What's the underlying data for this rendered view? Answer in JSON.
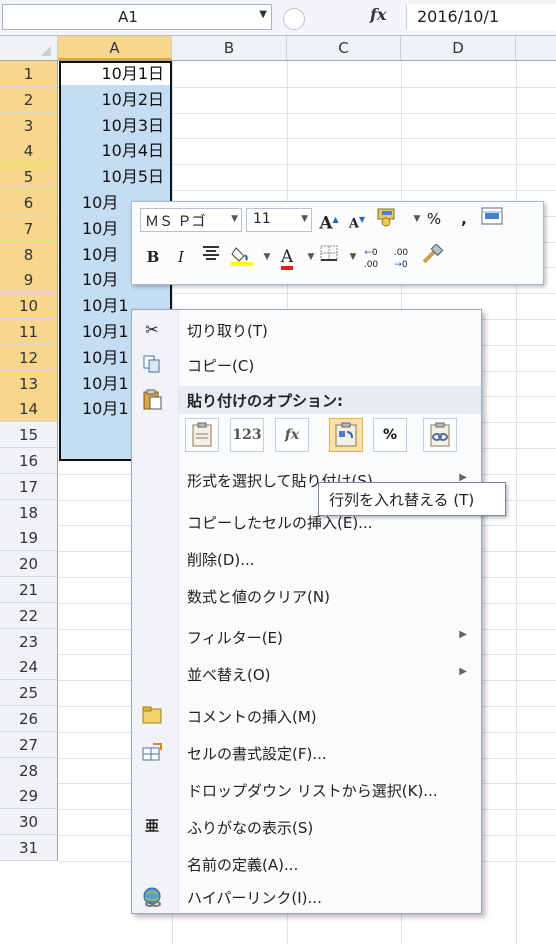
{
  "formula_bar": {
    "name_box": "A1",
    "fx_label": "fx",
    "value": "2016/10/1"
  },
  "columns": [
    "A",
    "B",
    "C",
    "D"
  ],
  "rows": [
    "1",
    "2",
    "3",
    "4",
    "5",
    "6",
    "7",
    "8",
    "9",
    "10",
    "11",
    "12",
    "13",
    "14",
    "15",
    "16",
    "17",
    "18",
    "19",
    "20",
    "21",
    "22",
    "23",
    "24",
    "25",
    "26",
    "27",
    "28",
    "29",
    "30",
    "31"
  ],
  "cells_a": [
    "10月1日",
    "10月2日",
    "10月3日",
    "10月4日",
    "10月5日",
    "10月",
    "10月",
    "10月",
    "10月",
    "10月1",
    "10月1",
    "10月1",
    "10月1",
    "10月1"
  ],
  "mini_toolbar": {
    "font": "ＭＳ Ｐゴ",
    "size": "11",
    "grow_font": "A",
    "shrink_font": "A",
    "percent": "%",
    "comma": ",",
    "bold": "B",
    "italic": "I",
    "font_color_letter": "A",
    "inc_decimal": ".00",
    "dec_decimal": ".00"
  },
  "context_menu": {
    "cut": "切り取り(T)",
    "copy": "コピー(C)",
    "paste_options_header": "貼り付けのオプション:",
    "paste_values_icon_text": "123",
    "paste_formula_icon_text": "fx",
    "paste_format_icon_text": "%",
    "paste_special": "形式を選択して貼り付け(S)",
    "insert_copied": "コピーしたセルの挿入(E)...",
    "delete": "削除(D)...",
    "clear": "数式と値のクリア(N)",
    "filter": "フィルター(E)",
    "sort": "並べ替え(O)",
    "insert_comment": "コメントの挿入(M)",
    "format_cells": "セルの書式設定(F)...",
    "dropdown_pick": "ドロップダウン リストから選択(K)...",
    "phonetic": "ふりがなの表示(S)",
    "define_name": "名前の定義(A)...",
    "hyperlink": "ハイパーリンク(I)..."
  },
  "tooltip": "行列を入れ替える (T)",
  "colors": {
    "selection": "#c5ddf3",
    "header_selected": "#f8d78d",
    "hover": "#fbe3a5"
  }
}
